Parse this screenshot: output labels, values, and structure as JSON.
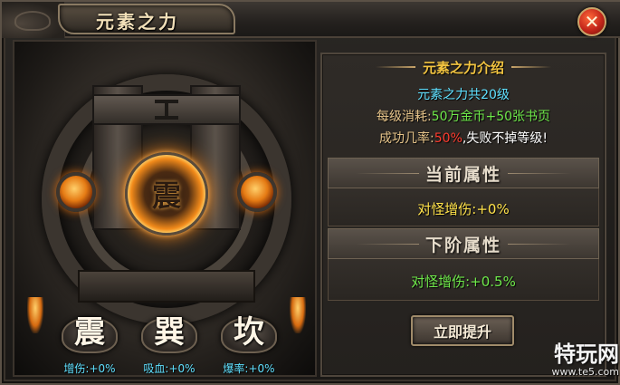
{
  "window": {
    "title": "元素之力",
    "close_glyph": "✕"
  },
  "art": {
    "core_rune": "震"
  },
  "trigrams": [
    {
      "glyph": "震",
      "stat": "增伤:+0%"
    },
    {
      "glyph": "巽",
      "stat": "吸血:+0%"
    },
    {
      "glyph": "坎",
      "stat": "爆率:+0%"
    }
  ],
  "info": {
    "title": "元素之力介绍",
    "total": "元素之力共20级",
    "cost_label": "每级消耗:",
    "cost_value": "50万金币+50张书页",
    "rate_label": "成功几率:",
    "rate_value": "50%",
    "rate_note": ",失败不掉等级!"
  },
  "current": {
    "header": "当前属性",
    "value": "对怪增伤:+0%"
  },
  "next": {
    "header": "下阶属性",
    "value": "对怪增伤:+0.5%"
  },
  "upgrade_label": "立即提升",
  "watermark": {
    "brand": "特玩网",
    "url": "www.te5.com"
  },
  "colors": {
    "cyan": "#5fe0ff",
    "gold": "#f2c440",
    "green": "#6ee84a",
    "red": "#ff3b2e",
    "accent_orange": "#ff8a1a"
  }
}
